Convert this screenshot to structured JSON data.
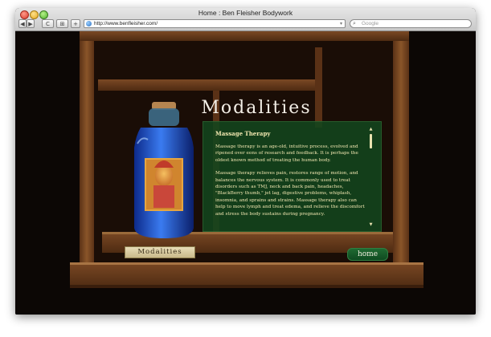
{
  "window": {
    "title": "Home : Ben Fleisher Bodywork"
  },
  "toolbar": {
    "back_label": "◀",
    "forward_label": "▶",
    "reload_label": "C",
    "bookmarks_label": "⊞",
    "add_label": "+",
    "url": "http://www.benfleisher.com/",
    "search_placeholder": "Google"
  },
  "page": {
    "heading": "Modalities",
    "panel": {
      "title": "Massage Therapy",
      "paragraphs": [
        "Massage therapy is an age-old, intuitive process, evolved and ripened over eons of research and feedback. It is perhaps the oldest known method of treating the human body.",
        "Massage therapy relieves pain, restores range of motion, and balances the nervous system. It is commonly used to treat disorders such as TMJ, neck and back pain, headaches, \"BlackBerry thumb,\" jet lag, digestive problems, whiplash, insomnia, and sprains and strains. Massage therapy also can help to move lymph and treat edema, and relieve the discomfort and stress the body sustains during pregnancy."
      ]
    },
    "plaque_label": "Modalities",
    "home_button_label": "home"
  },
  "colors": {
    "panel_bg": "#12461e",
    "panel_text": "#f0e6b0",
    "home_button": "#1f6a32",
    "wood": "#6b3e1e"
  }
}
